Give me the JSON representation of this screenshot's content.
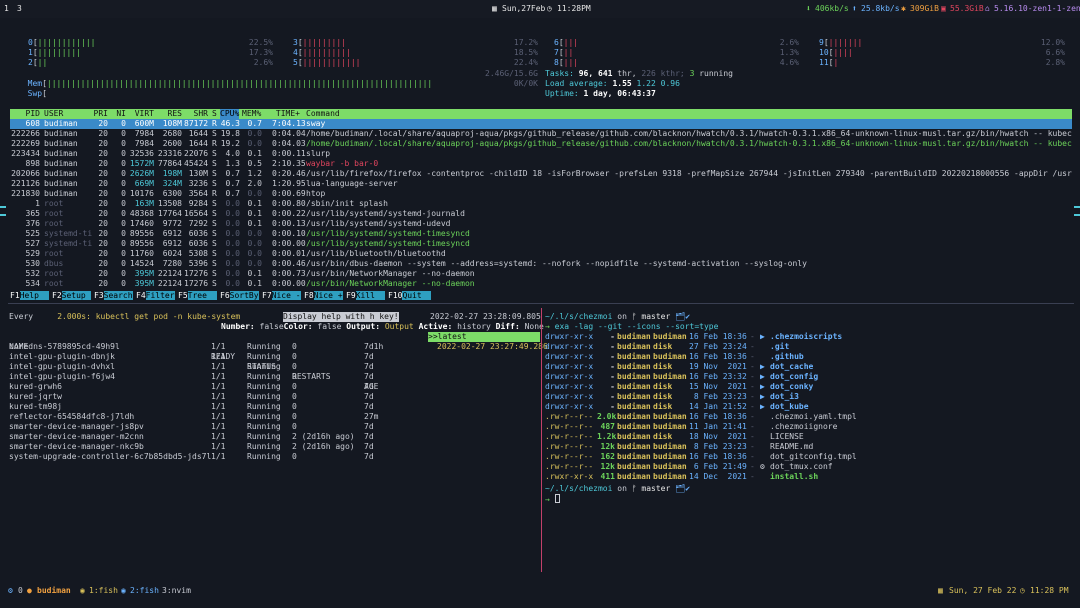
{
  "topbar": {
    "workspaces": [
      "1",
      "3"
    ],
    "date": "Sun,27Feb",
    "time": "11:28PM",
    "net_down": "406kb/s",
    "net_up": "25.8kb/s",
    "disk": "309GiB",
    "mem": "55.3GiB",
    "kernel": "5.16.10-zen1-1-zen"
  },
  "htop": {
    "cpus": [
      {
        "id": "0",
        "bars": "||||||||||||",
        "pct": "22.5%"
      },
      {
        "id": "1",
        "bars": "|||||||||",
        "pct": "17.3%"
      },
      {
        "id": "2",
        "bars": "||",
        "pct": "2.6%"
      },
      {
        "id": "3",
        "bars": "|||||||||",
        "pct": "17.2%"
      },
      {
        "id": "4",
        "bars": "||||||||||",
        "pct": "18.5%"
      },
      {
        "id": "5",
        "bars": "||||||||||||",
        "pct": "22.4%"
      },
      {
        "id": "6",
        "bars": "|||",
        "pct": "2.6%"
      },
      {
        "id": "7",
        "bars": "||",
        "pct": "1.3%"
      },
      {
        "id": "8",
        "bars": "|||",
        "pct": "4.6%"
      },
      {
        "id": "9",
        "bars": "|||||||",
        "pct": "12.0%"
      },
      {
        "id": "10",
        "bars": "||||",
        "pct": "6.6%"
      },
      {
        "id": "11",
        "bars": "|",
        "pct": "2.8%"
      }
    ],
    "mem": {
      "label": "Mem",
      "bars": "||||||||||||||||||||||||||||||||||||||||||||||||||||||||||||||||||||||||||||||||",
      "value": "2.46G/15.6G"
    },
    "swp": {
      "label": "Swp",
      "value": "0K/0K"
    },
    "tasks_label": "Tasks:",
    "tasks": "96,",
    "thr": "641",
    "thr_label": "thr,",
    "kthr": "226 kthr;",
    "running": "3",
    "running_label": "running",
    "load_label": "Load average:",
    "load1": "1.55",
    "load5": "1.22",
    "load15": "0.96",
    "uptime_label": "Uptime:",
    "uptime": "1 day, 06:43:37",
    "header": {
      "pid": "PID",
      "user": "USER",
      "pri": "PRI",
      "ni": "NI",
      "virt": "VIRT",
      "res": "RES",
      "shr": "SHR",
      "s": "S",
      "cpu": "CPU%",
      "mem": "MEM%",
      "time": "TIME+",
      "command": "Command"
    },
    "processes": [
      {
        "pid": "608",
        "user": "budiman",
        "pri": "20",
        "ni": "0",
        "virt": "600M",
        "res": "108M",
        "shr": "87172",
        "s": "R",
        "cpu": "46.3",
        "mem": "0.7",
        "time": "7:04.13",
        "command": "sway"
      },
      {
        "pid": "222266",
        "user": "budiman",
        "pri": "20",
        "ni": "0",
        "virt": "7984",
        "res": "2680",
        "shr": "1644",
        "s": "S",
        "cpu": "19.8",
        "mem": "0.0",
        "time": "0:04.04",
        "command": "/home/budiman/.local/share/aquaproj-aqua/pkgs/github_release/github.com/blacknon/hwatch/0.3.1/hwatch-0.3.1.x86_64-unknown-linux-musl.tar.gz/bin/hwatch -- kubectl get pod"
      },
      {
        "pid": "222269",
        "user": "budiman",
        "pri": "20",
        "ni": "0",
        "virt": "7984",
        "res": "2600",
        "shr": "1644",
        "s": "R",
        "cpu": "19.2",
        "mem": "0.0",
        "time": "0:04.03",
        "command": "/home/budiman/.local/share/aquaproj-aqua/pkgs/github_release/github.com/blacknon/hwatch/0.3.1/hwatch-0.3.1.x86_64-unknown-linux-musl.tar.gz/bin/hwatch -- kubectl get pod"
      },
      {
        "pid": "223434",
        "user": "budiman",
        "pri": "20",
        "ni": "0",
        "virt": "32536",
        "res": "23316",
        "shr": "22076",
        "s": "S",
        "cpu": "4.0",
        "mem": "0.1",
        "time": "0:00.11",
        "command": "slurp"
      },
      {
        "pid": "898",
        "user": "budiman",
        "pri": "20",
        "ni": "0",
        "virt": "1572M",
        "res": "77864",
        "shr": "45424",
        "s": "S",
        "cpu": "1.3",
        "mem": "0.5",
        "time": "2:10.35",
        "command": "waybar -b bar-0"
      },
      {
        "pid": "202066",
        "user": "budiman",
        "pri": "20",
        "ni": "0",
        "virt": "2626M",
        "res": "198M",
        "shr": "130M",
        "s": "S",
        "cpu": "0.7",
        "mem": "1.2",
        "time": "0:20.46",
        "command": "/usr/lib/firefox/firefox -contentproc -childID 18 -isForBrowser -prefsLen 9318 -prefMapSize 267944 -jsInitLen 279340 -parentBuildID 20220218000556 -appDir /usr/lib/firefo"
      },
      {
        "pid": "221126",
        "user": "budiman",
        "pri": "20",
        "ni": "0",
        "virt": "669M",
        "res": "324M",
        "shr": "3236",
        "s": "S",
        "cpu": "0.7",
        "mem": "2.0",
        "time": "1:20.95",
        "command": "lua-language-server"
      },
      {
        "pid": "221830",
        "user": "budiman",
        "pri": "20",
        "ni": "0",
        "virt": "10176",
        "res": "6300",
        "shr": "3564",
        "s": "R",
        "cpu": "0.7",
        "mem": "0.0",
        "time": "0:00.69",
        "command": "htop"
      },
      {
        "pid": "1",
        "user": "root",
        "pri": "20",
        "ni": "0",
        "virt": "163M",
        "res": "13508",
        "shr": "9284",
        "s": "S",
        "cpu": "0.0",
        "mem": "0.1",
        "time": "0:00.80",
        "command": "/sbin/init splash"
      },
      {
        "pid": "365",
        "user": "root",
        "pri": "20",
        "ni": "0",
        "virt": "48368",
        "res": "17764",
        "shr": "16564",
        "s": "S",
        "cpu": "0.0",
        "mem": "0.1",
        "time": "0:00.22",
        "command": "/usr/lib/systemd/systemd-journald"
      },
      {
        "pid": "376",
        "user": "root",
        "pri": "20",
        "ni": "0",
        "virt": "17460",
        "res": "9772",
        "shr": "7292",
        "s": "S",
        "cpu": "0.0",
        "mem": "0.1",
        "time": "0:00.13",
        "command": "/usr/lib/systemd/systemd-udevd"
      },
      {
        "pid": "525",
        "user": "systemd-ti",
        "pri": "20",
        "ni": "0",
        "virt": "89556",
        "res": "6912",
        "shr": "6036",
        "s": "S",
        "cpu": "0.0",
        "mem": "0.0",
        "time": "0:00.10",
        "command": "/usr/lib/systemd/systemd-timesyncd"
      },
      {
        "pid": "527",
        "user": "systemd-ti",
        "pri": "20",
        "ni": "0",
        "virt": "89556",
        "res": "6912",
        "shr": "6036",
        "s": "S",
        "cpu": "0.0",
        "mem": "0.0",
        "time": "0:00.00",
        "command": "/usr/lib/systemd/systemd-timesyncd"
      },
      {
        "pid": "529",
        "user": "root",
        "pri": "20",
        "ni": "0",
        "virt": "11760",
        "res": "6024",
        "shr": "5308",
        "s": "S",
        "cpu": "0.0",
        "mem": "0.0",
        "time": "0:00.01",
        "command": "/usr/lib/bluetooth/bluetoothd"
      },
      {
        "pid": "530",
        "user": "dbus",
        "pri": "20",
        "ni": "0",
        "virt": "14524",
        "res": "7280",
        "shr": "5396",
        "s": "S",
        "cpu": "0.0",
        "mem": "0.0",
        "time": "0:00.46",
        "command": "/usr/bin/dbus-daemon --system --address=systemd: --nofork --nopidfile --systemd-activation --syslog-only"
      },
      {
        "pid": "532",
        "user": "root",
        "pri": "20",
        "ni": "0",
        "virt": "395M",
        "res": "22124",
        "shr": "17276",
        "s": "S",
        "cpu": "0.0",
        "mem": "0.1",
        "time": "0:00.73",
        "command": "/usr/bin/NetworkManager --no-daemon"
      },
      {
        "pid": "534",
        "user": "root",
        "pri": "20",
        "ni": "0",
        "virt": "395M",
        "res": "22124",
        "shr": "17276",
        "s": "S",
        "cpu": "0.0",
        "mem": "0.1",
        "time": "0:00.00",
        "command": "/usr/bin/NetworkManager --no-daemon"
      }
    ],
    "fkeys": [
      {
        "key": "F1",
        "label": "Help  "
      },
      {
        "key": "F2",
        "label": "Setup "
      },
      {
        "key": "F3",
        "label": "Search"
      },
      {
        "key": "F4",
        "label": "Filter"
      },
      {
        "key": "F5",
        "label": "Tree  "
      },
      {
        "key": "F6",
        "label": "SortBy"
      },
      {
        "key": "F7",
        "label": "Nice -"
      },
      {
        "key": "F8",
        "label": "Nice +"
      },
      {
        "key": "F9",
        "label": "Kill  "
      },
      {
        "key": "F10",
        "label": "Quit  "
      }
    ]
  },
  "hwatch": {
    "every_label": "Every",
    "interval": "2.000s:",
    "command": "kubectl get pod -n kube-system",
    "help": "Display help with h key!",
    "timestamp": "2022-02-27 23:28:09.805",
    "number_label": "Number:",
    "number_val": "false",
    "color_label": "Color:",
    "color_val": "false",
    "output_label": "Output:",
    "output_val": "Output",
    "active_label": "Active:",
    "active_val": "history",
    "diff_label": "Diff:",
    "diff_val": "None",
    "history": [
      {
        "label": ">>latest"
      },
      {
        "label": "2022-02-27 23:27:49.286"
      }
    ],
    "columns": [
      "NAME",
      "READY",
      "STATUS",
      "RESTARTS",
      "AGE"
    ],
    "pods": [
      {
        "name": "coredns-5789895cd-49h9l",
        "ready": "1/1",
        "status": "Running",
        "restarts": "0",
        "age": "7d1h"
      },
      {
        "name": "intel-gpu-plugin-dbnjk",
        "ready": "1/1",
        "status": "Running",
        "restarts": "0",
        "age": "7d"
      },
      {
        "name": "intel-gpu-plugin-dvhxl",
        "ready": "1/1",
        "status": "Running",
        "restarts": "0",
        "age": "7d"
      },
      {
        "name": "intel-gpu-plugin-f6jw4",
        "ready": "1/1",
        "status": "Running",
        "restarts": "0",
        "age": "7d"
      },
      {
        "name": "kured-grwh6",
        "ready": "1/1",
        "status": "Running",
        "restarts": "0",
        "age": "7d"
      },
      {
        "name": "kured-jqrtw",
        "ready": "1/1",
        "status": "Running",
        "restarts": "0",
        "age": "7d"
      },
      {
        "name": "kured-tm98j",
        "ready": "1/1",
        "status": "Running",
        "restarts": "0",
        "age": "7d"
      },
      {
        "name": "reflector-654584dfc8-j7ldh",
        "ready": "1/1",
        "status": "Running",
        "restarts": "0",
        "age": "27m"
      },
      {
        "name": "smarter-device-manager-js8pv",
        "ready": "1/1",
        "status": "Running",
        "restarts": "0",
        "age": "7d"
      },
      {
        "name": "smarter-device-manager-m2cnn",
        "ready": "1/1",
        "status": "Running",
        "restarts": "2 (2d16h ago)",
        "age": "7d"
      },
      {
        "name": "smarter-device-manager-nkc9b",
        "ready": "1/1",
        "status": "Running",
        "restarts": "2 (2d16h ago)",
        "age": "7d"
      },
      {
        "name": "system-upgrade-controller-6c7b85dbd5-jds7l",
        "ready": "1/1",
        "status": "Running",
        "restarts": "0",
        "age": "7d"
      }
    ]
  },
  "shell": {
    "path": "~/.l/s/chezmoi",
    "on": "on",
    "branch_icon": "ᚠ",
    "branch": "master",
    "badges": "🗂✔",
    "command": "exa -lag --git --icons --sort=type",
    "prompt2_path": "~/.l/s/chezmoi",
    "prompt2_on": "on",
    "prompt2_branch": "master",
    "entries": [
      {
        "perm": "drwxr-xr-x",
        "size": "-",
        "user": "budiman",
        "group": "budiman",
        "date": "16 Feb 18:36",
        "git": "-",
        "icon": "▶",
        "name": ".chezmoiscripts"
      },
      {
        "perm": "drwxr-xr-x",
        "size": "-",
        "user": "budiman",
        "group": "disk",
        "date": "27 Feb 23:24",
        "git": "-",
        "icon": "",
        "name": ".git"
      },
      {
        "perm": "drwxr-xr-x",
        "size": "-",
        "user": "budiman",
        "group": "budiman",
        "date": "16 Feb 18:36",
        "git": "-",
        "icon": "",
        "name": ".github"
      },
      {
        "perm": "drwxr-xr-x",
        "size": "-",
        "user": "budiman",
        "group": "disk",
        "date": "19 Nov  2021",
        "git": "-",
        "icon": "▶",
        "name": "dot_cache"
      },
      {
        "perm": "drwxr-xr-x",
        "size": "-",
        "user": "budiman",
        "group": "budiman",
        "date": "16 Feb 23:32",
        "git": "-",
        "icon": "▶",
        "name": "dot_config"
      },
      {
        "perm": "drwxr-xr-x",
        "size": "-",
        "user": "budiman",
        "group": "disk",
        "date": "15 Nov  2021",
        "git": "-",
        "icon": "▶",
        "name": "dot_conky"
      },
      {
        "perm": "drwxr-xr-x",
        "size": "-",
        "user": "budiman",
        "group": "disk",
        "date": " 8 Feb 23:23",
        "git": "-",
        "icon": "▶",
        "name": "dot_i3"
      },
      {
        "perm": "drwxr-xr-x",
        "size": "-",
        "user": "budiman",
        "group": "disk",
        "date": "14 Jan 21:52",
        "git": "-",
        "icon": "▶",
        "name": "dot_kube"
      },
      {
        "perm": ".rw-r--r--",
        "size": "2.0k",
        "user": "budiman",
        "group": "budiman",
        "date": "16 Feb 18:36",
        "git": "-",
        "icon": "",
        "name": ".chezmoi.yaml.tmpl"
      },
      {
        "perm": ".rw-r--r--",
        "size": "487",
        "user": "budiman",
        "group": "budiman",
        "date": "11 Jan 21:41",
        "git": "-",
        "icon": "",
        "name": ".chezmoiignore"
      },
      {
        "perm": ".rw-r--r--",
        "size": "1.2k",
        "user": "budiman",
        "group": "disk",
        "date": "18 Nov  2021",
        "git": "-",
        "icon": "",
        "name": "LICENSE"
      },
      {
        "perm": ".rw-r--r--",
        "size": "12k",
        "user": "budiman",
        "group": "budiman",
        "date": " 8 Feb 23:23",
        "git": "-",
        "icon": "",
        "name": "README.md"
      },
      {
        "perm": ".rw-r--r--",
        "size": "162",
        "user": "budiman",
        "group": "budiman",
        "date": "16 Feb 18:36",
        "git": "-",
        "icon": "",
        "name": "dot_gitconfig.tmpl"
      },
      {
        "perm": ".rw-r--r--",
        "size": "12k",
        "user": "budiman",
        "group": "budiman",
        "date": " 6 Feb 21:49",
        "git": "-",
        "icon": "⚙",
        "name": "dot_tmux.conf"
      },
      {
        "perm": ".rwxr-xr-x",
        "size": "411",
        "user": "budiman",
        "group": "budiman",
        "date": "14 Dec  2021",
        "git": "-",
        "icon": "",
        "name": "install.sh"
      }
    ]
  },
  "tmux": {
    "session": "0",
    "user": "budiman",
    "windows": [
      {
        "label": "1:fish"
      },
      {
        "label": "2:fish"
      },
      {
        "label": "3:nvim"
      }
    ],
    "date": "Sun, 27 Feb 22",
    "time": "11:28 PM"
  },
  "colors": {
    "accent": "#6cd35a",
    "selection": "#3a8ac9",
    "separator": "#c2406a"
  }
}
